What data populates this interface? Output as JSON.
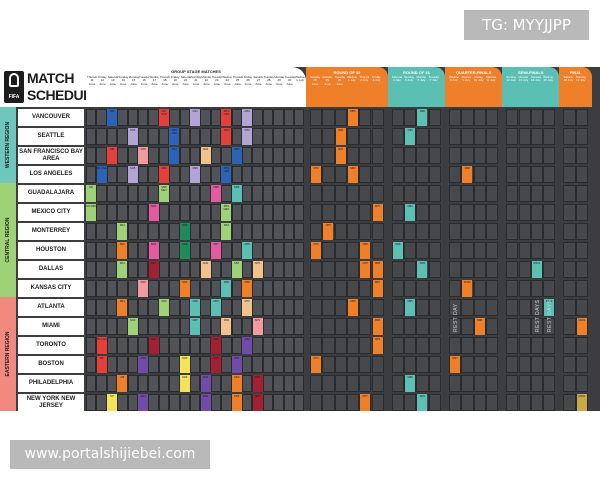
{
  "watermark_top": "TG: MYYJJPP",
  "watermark_bottom": "www.portalshijiebei.com",
  "logo": {
    "brand": "FIFA",
    "line1": "MATCH",
    "line2": "SCHEDULE"
  },
  "group_header": "GROUP STAGE MATCHES",
  "group_dates": [
    "Thursday 11 June",
    "Friday 12 June",
    "Saturday 13 June",
    "Sunday 14 June",
    "Monday 15 June",
    "Tuesday 16 June",
    "Wednesday 17 June",
    "Thursday 18 June",
    "Friday 19 June",
    "Saturday 20 June",
    "Sunday 21 June",
    "Monday 22 June",
    "Tuesday 23 June",
    "Wednesday 24 June",
    "Thursday 25 June",
    "Friday 26 June",
    "Saturday 27 June",
    "Sunday 28 June",
    "Monday 29 June",
    "Tuesday 30 June",
    "Wednesday 1 July"
  ],
  "phases": [
    {
      "title": "ROUND OF 32",
      "color": "#f07f2a",
      "dates": [
        "Sunday 28 June",
        "Monday 29 June",
        "Tuesday 30 June",
        "Wednesday 1 July",
        "Thursday 2 July",
        "Friday 3 July"
      ]
    },
    {
      "title": "ROUND OF 16",
      "color": "#5bbfb4",
      "dates": [
        "Saturday 4 July",
        "Sunday 5 July",
        "Monday 6 July",
        "Tuesday 7 July"
      ]
    },
    {
      "title": "QUARTER-FINALS",
      "color": "#f07f2a",
      "dates": [
        "Wednesday 8 July",
        "Thursday 9 July",
        "Friday 10 July",
        "Saturday 11 July"
      ]
    },
    {
      "title": "SEMI-FINALS",
      "color": "#5bbfb4",
      "dates": [
        "Sunday 12 July",
        "Monday 13 July",
        "Tuesday 14 July",
        "Wednesday 15 July"
      ]
    },
    {
      "title": "FINAL",
      "color": "#f07f2a",
      "dates": [
        "Saturday 18 July",
        "Sunday 19 July"
      ]
    }
  ],
  "regions": [
    {
      "label": "WESTERN REGION",
      "color": "#6fc6bd"
    },
    {
      "label": "CENTRAL REGION",
      "color": "#9fd277"
    },
    {
      "label": "EASTERN REGION",
      "color": "#f2897f"
    }
  ],
  "venues": [
    "VANCOUVER",
    "SEATTLE",
    "SAN FRANCISCO BAY AREA",
    "LOS ANGELES",
    "GUADALAJARA",
    "MEXICO CITY",
    "MONTERREY",
    "HOUSTON",
    "DALLAS",
    "KANSAS CITY",
    "ATLANTA",
    "MIAMI",
    "TORONTO",
    "BOSTON",
    "PHILADELPHIA",
    "NEW YORK NEW JERSEY"
  ],
  "rest_day_label": "REST DAY",
  "rest_days_label": "REST DAYS",
  "matches": [
    {
      "venue": 0,
      "day": 2,
      "color": "#2c63b7",
      "label": "M6"
    },
    {
      "venue": 0,
      "day": 7,
      "color": "#e53f3a",
      "label": "M27 CAN"
    },
    {
      "venue": 0,
      "day": 10,
      "color": "#b3a4d6",
      "label": "M40"
    },
    {
      "venue": 0,
      "day": 13,
      "color": "#e53f3a",
      "label": "M51 CAN"
    },
    {
      "venue": 0,
      "day": 15,
      "color": "#b3a4d6",
      "label": "M64"
    },
    {
      "venue": 1,
      "day": 4,
      "color": "#b3a4d6",
      "label": "M16"
    },
    {
      "venue": 1,
      "day": 8,
      "color": "#2c63b7",
      "label": "M32 USA"
    },
    {
      "venue": 1,
      "day": 13,
      "color": "#e53f3a",
      "label": "M52"
    },
    {
      "venue": 1,
      "day": 15,
      "color": "#b3a4d6",
      "label": "M63"
    },
    {
      "venue": 2,
      "day": 2,
      "color": "#e53f3a",
      "label": "M8"
    },
    {
      "venue": 2,
      "day": 5,
      "color": "#f19aa0",
      "label": "M19"
    },
    {
      "venue": 2,
      "day": 8,
      "color": "#2c63b7",
      "label": "M31"
    },
    {
      "venue": 2,
      "day": 11,
      "color": "#f2c28c",
      "label": "M44"
    },
    {
      "venue": 2,
      "day": 14,
      "color": "#2c63b7",
      "label": "M55"
    },
    {
      "venue": 3,
      "day": 1,
      "color": "#2c63b7",
      "label": "M4 USA"
    },
    {
      "venue": 3,
      "day": 4,
      "color": "#b3a4d6",
      "label": "M15"
    },
    {
      "venue": 3,
      "day": 7,
      "color": "#e53f3a",
      "label": "M26"
    },
    {
      "venue": 3,
      "day": 10,
      "color": "#b3a4d6",
      "label": "M39"
    },
    {
      "venue": 3,
      "day": 13,
      "color": "#2c63b7",
      "label": "M59 USA"
    },
    {
      "venue": 4,
      "day": 0,
      "color": "#9fd277",
      "label": "M2"
    },
    {
      "venue": 4,
      "day": 7,
      "color": "#9fd277",
      "label": "M28 MEX"
    },
    {
      "venue": 4,
      "day": 12,
      "color": "#e45aa0",
      "label": "M48"
    },
    {
      "venue": 4,
      "day": 14,
      "color": "#5bbfb4",
      "label": "M66"
    },
    {
      "venue": 5,
      "day": 0,
      "color": "#9fd277",
      "label": "M1 MEX"
    },
    {
      "venue": 5,
      "day": 6,
      "color": "#e45aa0",
      "label": "M24"
    },
    {
      "venue": 5,
      "day": 13,
      "color": "#9fd277",
      "label": "M53 MEX"
    },
    {
      "venue": 6,
      "day": 3,
      "color": "#9fd277",
      "label": "M12"
    },
    {
      "venue": 6,
      "day": 9,
      "color": "#1f8a5b",
      "label": "M35"
    },
    {
      "venue": 6,
      "day": 13,
      "color": "#9fd277",
      "label": "M54"
    },
    {
      "venue": 7,
      "day": 3,
      "color": "#f07f2a",
      "label": "M10"
    },
    {
      "venue": 7,
      "day": 6,
      "color": "#e45aa0",
      "label": "M23"
    },
    {
      "venue": 7,
      "day": 9,
      "color": "#1f8a5b",
      "label": "M36"
    },
    {
      "venue": 7,
      "day": 12,
      "color": "#e45aa0",
      "label": "M47"
    },
    {
      "venue": 7,
      "day": 15,
      "color": "#5bbfb4",
      "label": "M65"
    },
    {
      "venue": 8,
      "day": 3,
      "color": "#9fd277",
      "label": "M11"
    },
    {
      "venue": 8,
      "day": 6,
      "color": "#a32032",
      "label": "M22"
    },
    {
      "venue": 8,
      "day": 11,
      "color": "#f2c28c",
      "label": "M43"
    },
    {
      "venue": 8,
      "day": 14,
      "color": "#9fd277",
      "label": "M57"
    },
    {
      "venue": 8,
      "day": 16,
      "color": "#f2c28c",
      "label": "M70"
    },
    {
      "venue": 9,
      "day": 5,
      "color": "#f19aa0",
      "label": "M19"
    },
    {
      "venue": 9,
      "day": 9,
      "color": "#f07f2a",
      "label": "M34"
    },
    {
      "venue": 9,
      "day": 13,
      "color": "#5bbfb4",
      "label": "M58"
    },
    {
      "venue": 9,
      "day": 15,
      "color": "#f07f2a",
      "label": "M69"
    },
    {
      "venue": 10,
      "day": 3,
      "color": "#f07f2a",
      "label": "M14"
    },
    {
      "venue": 10,
      "day": 7,
      "color": "#9fd277",
      "label": "M25"
    },
    {
      "venue": 10,
      "day": 10,
      "color": "#5bbfb4",
      "label": "M38"
    },
    {
      "venue": 10,
      "day": 12,
      "color": "#5bbfb4",
      "label": "M50"
    },
    {
      "venue": 10,
      "day": 15,
      "color": "#f2c28c",
      "label": "M72"
    },
    {
      "venue": 11,
      "day": 4,
      "color": "#9fd277",
      "label": "M13"
    },
    {
      "venue": 11,
      "day": 10,
      "color": "#5bbfb4",
      "label": "M37"
    },
    {
      "venue": 11,
      "day": 13,
      "color": "#f2c28c",
      "label": "M49"
    },
    {
      "venue": 11,
      "day": 16,
      "color": "#f19aa0",
      "label": "M71"
    },
    {
      "venue": 12,
      "day": 1,
      "color": "#e53f3a",
      "label": "M3 CAN"
    },
    {
      "venue": 12,
      "day": 6,
      "color": "#a32032",
      "label": "M21"
    },
    {
      "venue": 12,
      "day": 12,
      "color": "#a32032",
      "label": "M46"
    },
    {
      "venue": 12,
      "day": 15,
      "color": "#6f4ca8",
      "label": "M62"
    },
    {
      "venue": 13,
      "day": 1,
      "color": "#e53f3a",
      "label": "M5"
    },
    {
      "venue": 13,
      "day": 5,
      "color": "#6f4ca8",
      "label": "M18"
    },
    {
      "venue": 13,
      "day": 9,
      "color": "#f2e35a",
      "label": "M30"
    },
    {
      "venue": 13,
      "day": 12,
      "color": "#a32032",
      "label": "M45"
    },
    {
      "venue": 13,
      "day": 14,
      "color": "#6f4ca8",
      "label": "M61"
    },
    {
      "venue": 14,
      "day": 3,
      "color": "#f07f2a",
      "label": "M9"
    },
    {
      "venue": 14,
      "day": 9,
      "color": "#f2e35a",
      "label": "M29"
    },
    {
      "venue": 14,
      "day": 11,
      "color": "#6f4ca8",
      "label": "M42"
    },
    {
      "venue": 14,
      "day": 14,
      "color": "#f07f2a",
      "label": "M60"
    },
    {
      "venue": 14,
      "day": 16,
      "color": "#a32032",
      "label": "M68"
    },
    {
      "venue": 15,
      "day": 2,
      "color": "#f2e35a",
      "label": "M7"
    },
    {
      "venue": 15,
      "day": 5,
      "color": "#6f4ca8",
      "label": "M17"
    },
    {
      "venue": 15,
      "day": 11,
      "color": "#6f4ca8",
      "label": "M41"
    },
    {
      "venue": 15,
      "day": 14,
      "color": "#f07f2a",
      "label": "M56"
    },
    {
      "venue": 15,
      "day": 16,
      "color": "#a32032",
      "label": "M67"
    }
  ],
  "knockout_matches": [
    {
      "venue": 0,
      "col": 3,
      "color": "#f07f2a",
      "label": "M85"
    },
    {
      "venue": 0,
      "col": 8,
      "color": "#5bbfb4",
      "label": "M96"
    },
    {
      "venue": 1,
      "col": 2,
      "color": "#f07f2a",
      "label": "M82"
    },
    {
      "venue": 1,
      "col": 7,
      "color": "#5bbfb4",
      "label": "M94"
    },
    {
      "venue": 2,
      "col": 2,
      "color": "#f07f2a",
      "label": "M81"
    },
    {
      "venue": 3,
      "col": 0,
      "color": "#f07f2a",
      "label": "M73"
    },
    {
      "venue": 3,
      "col": 3,
      "color": "#f07f2a",
      "label": "M84"
    },
    {
      "venue": 3,
      "col": 11,
      "color": "#f07f2a",
      "label": "M98"
    },
    {
      "venue": 5,
      "col": 5,
      "color": "#f07f2a",
      "label": "M79"
    },
    {
      "venue": 5,
      "col": 7,
      "color": "#5bbfb4",
      "label": "M92"
    },
    {
      "venue": 6,
      "col": 1,
      "color": "#f07f2a",
      "label": "M76"
    },
    {
      "venue": 7,
      "col": 0,
      "color": "#f07f2a",
      "label": "M76"
    },
    {
      "venue": 7,
      "col": 4,
      "color": "#f07f2a",
      "label": "M83"
    },
    {
      "venue": 7,
      "col": 6,
      "color": "#5bbfb4",
      "label": "M90"
    },
    {
      "venue": 8,
      "col": 4,
      "color": "#f07f2a",
      "label": "M78"
    },
    {
      "venue": 8,
      "col": 5,
      "color": "#f07f2a",
      "label": "M88"
    },
    {
      "venue": 8,
      "col": 8,
      "color": "#5bbfb4",
      "label": "M93"
    },
    {
      "venue": 8,
      "col": 16,
      "color": "#5bbfb4",
      "label": "M101"
    },
    {
      "venue": 9,
      "col": 5,
      "color": "#f07f2a",
      "label": "M87"
    },
    {
      "venue": 9,
      "col": 11,
      "color": "#f07f2a",
      "label": "M100"
    },
    {
      "venue": 10,
      "col": 3,
      "color": "#f07f2a",
      "label": "M80"
    },
    {
      "venue": 10,
      "col": 7,
      "color": "#5bbfb4",
      "label": "M95"
    },
    {
      "venue": 10,
      "col": 17,
      "color": "#5bbfb4",
      "label": "M102"
    },
    {
      "venue": 11,
      "col": 5,
      "color": "#f07f2a",
      "label": "M86"
    },
    {
      "venue": 11,
      "col": 12,
      "color": "#f07f2a",
      "label": "M99"
    },
    {
      "venue": 11,
      "col": 20,
      "color": "#f07f2a",
      "label": "M103"
    },
    {
      "venue": 12,
      "col": 5,
      "color": "#f07f2a",
      "label": "M83"
    },
    {
      "venue": 13,
      "col": 0,
      "color": "#f07f2a",
      "label": "M74"
    },
    {
      "venue": 13,
      "col": 10,
      "color": "#f07f2a",
      "label": "M97"
    },
    {
      "venue": 14,
      "col": 7,
      "color": "#5bbfb4",
      "label": "M89"
    },
    {
      "venue": 15,
      "col": 4,
      "color": "#f07f2a",
      "label": "M77"
    },
    {
      "venue": 15,
      "col": 8,
      "color": "#5bbfb4",
      "label": "M91"
    },
    {
      "venue": 15,
      "col": 21,
      "color": "#c9a84a",
      "label": "M104"
    }
  ]
}
